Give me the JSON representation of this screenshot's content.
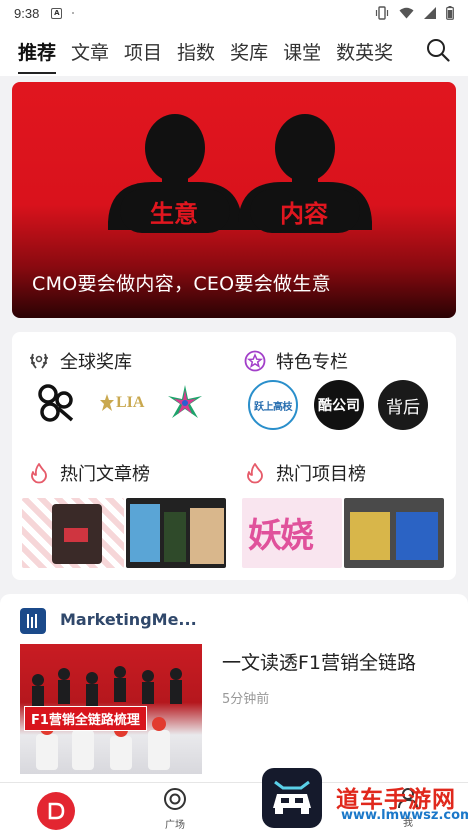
{
  "status_bar": {
    "time": "9:38",
    "notif_icon": "A"
  },
  "nav": {
    "tabs": [
      "推荐",
      "文章",
      "项目",
      "指数",
      "奖库",
      "课堂",
      "数英奖"
    ],
    "active_index": 0
  },
  "banner": {
    "left_badge": "生意",
    "right_badge": "内容",
    "caption": "CMO要会做内容，CEO要会做生意"
  },
  "sections": {
    "awards": "全球奖库",
    "columns": "特色专栏",
    "hot_articles": "热门文章榜",
    "hot_projects": "热门项目榜"
  },
  "award_logos": {
    "lia": "LIA",
    "dandad": "D&AD"
  },
  "column_logos": {
    "c1": "跃上高枝",
    "c2": "酷公司",
    "c3": "背后"
  },
  "thumbs": {
    "project1_text": "妖娆"
  },
  "article": {
    "author": "MarketingMe...",
    "title": "一文读透F1营销全链路",
    "time": "5分钟前",
    "image_label": "F1营销全链路梳理"
  },
  "bottom_nav": {
    "plaza_label": "广场",
    "me_label": "我"
  },
  "watermark": {
    "text": "道车手游网",
    "url": "www.lmwwsz.com"
  },
  "colors": {
    "brand_red": "#e32631",
    "banner_red": "#e1161f"
  }
}
